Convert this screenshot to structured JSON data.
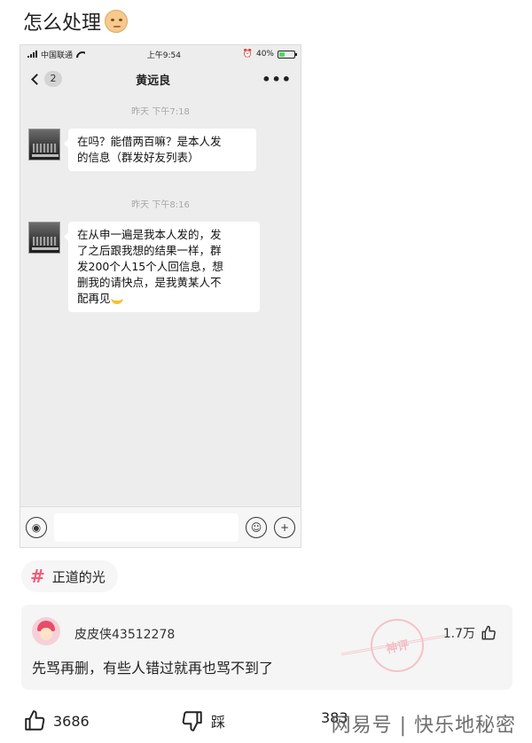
{
  "post": {
    "title": "怎么处理"
  },
  "phone": {
    "status": {
      "carrier": "中国联通",
      "time": "上午9:54",
      "battery": "40%",
      "battery_level": 0.4
    },
    "header": {
      "back_count": "2",
      "contact_name": "黄远良",
      "more": "•••"
    },
    "messages": [
      {
        "timestamp": "昨天 下午7:18",
        "lines": [
          "在吗？能借两百嘛？是本人发",
          "的信息（群发好友列表）"
        ]
      },
      {
        "timestamp": "昨天 下午8:16",
        "lines": [
          "在从申一遍是我本人发的，发",
          "了之后跟我想的结果一样，群",
          "发200个人15个人回信息，想",
          "删我的请快点，是我黄某人不",
          "配再见"
        ]
      }
    ]
  },
  "tag": {
    "hash": "#",
    "label": "正道的光"
  },
  "comment": {
    "username": "皮皮侠43512278",
    "likes": "1.7万",
    "text": "先骂再删，有些人错过就再也骂不到了",
    "stamp": "神评"
  },
  "actions": {
    "like_count": "3686",
    "dislike_label": "踩",
    "share_count": "383"
  },
  "watermark": "网易号 | 快乐地秘密"
}
